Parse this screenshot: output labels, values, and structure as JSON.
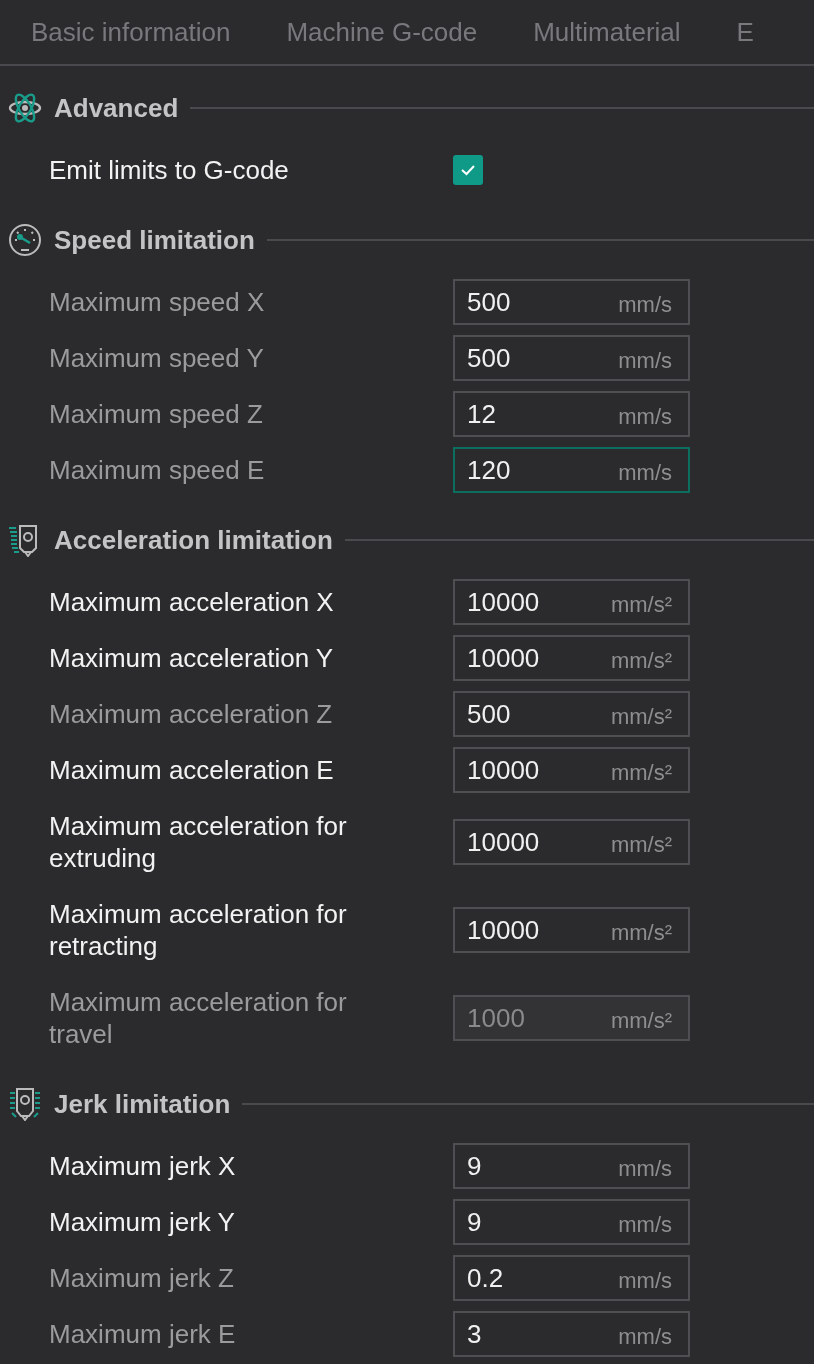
{
  "tabs": [
    {
      "label": "Basic information",
      "selected": false
    },
    {
      "label": "Machine G-code",
      "selected": false
    },
    {
      "label": "Multimaterial",
      "selected": false
    },
    {
      "label": "E",
      "selected": false
    }
  ],
  "sections": [
    {
      "title": "Advanced",
      "rows": [
        {
          "kind": "checkbox",
          "label": "Emit limits to G-code",
          "modified": true,
          "checked": true
        }
      ]
    },
    {
      "title": "Speed limitation",
      "rows": [
        {
          "kind": "field",
          "label": "Maximum speed X",
          "modified": false,
          "value": "500",
          "unit": "mm/s",
          "focused": false,
          "disabled": false
        },
        {
          "kind": "field",
          "label": "Maximum speed Y",
          "modified": false,
          "value": "500",
          "unit": "mm/s",
          "focused": false,
          "disabled": false
        },
        {
          "kind": "field",
          "label": "Maximum speed Z",
          "modified": false,
          "value": "12",
          "unit": "mm/s",
          "focused": false,
          "disabled": false
        },
        {
          "kind": "field",
          "label": "Maximum speed E",
          "modified": false,
          "value": "120",
          "unit": "mm/s",
          "focused": true,
          "disabled": false
        }
      ]
    },
    {
      "title": "Acceleration limitation",
      "rows": [
        {
          "kind": "field",
          "label": "Maximum acceleration X",
          "modified": true,
          "value": "10000",
          "unit": "mm/s²",
          "focused": false,
          "disabled": false
        },
        {
          "kind": "field",
          "label": "Maximum acceleration Y",
          "modified": true,
          "value": "10000",
          "unit": "mm/s²",
          "focused": false,
          "disabled": false
        },
        {
          "kind": "field",
          "label": "Maximum acceleration Z",
          "modified": false,
          "value": "500",
          "unit": "mm/s²",
          "focused": false,
          "disabled": false
        },
        {
          "kind": "field",
          "label": "Maximum acceleration E",
          "modified": true,
          "value": "10000",
          "unit": "mm/s²",
          "focused": false,
          "disabled": false
        },
        {
          "kind": "field",
          "label": "Maximum acceleration for extruding",
          "modified": true,
          "value": "10000",
          "unit": "mm/s²",
          "focused": false,
          "disabled": false
        },
        {
          "kind": "field",
          "label": "Maximum acceleration for retracting",
          "modified": true,
          "value": "10000",
          "unit": "mm/s²",
          "focused": false,
          "disabled": false
        },
        {
          "kind": "field",
          "label": "Maximum acceleration for travel",
          "modified": false,
          "value": "1000",
          "unit": "mm/s²",
          "focused": false,
          "disabled": true
        }
      ]
    },
    {
      "title": "Jerk limitation",
      "rows": [
        {
          "kind": "field",
          "label": "Maximum jerk X",
          "modified": true,
          "value": "9",
          "unit": "mm/s",
          "focused": false,
          "disabled": false
        },
        {
          "kind": "field",
          "label": "Maximum jerk Y",
          "modified": true,
          "value": "9",
          "unit": "mm/s",
          "focused": false,
          "disabled": false
        },
        {
          "kind": "field",
          "label": "Maximum jerk Z",
          "modified": false,
          "value": "0.2",
          "unit": "mm/s",
          "focused": false,
          "disabled": false
        },
        {
          "kind": "field",
          "label": "Maximum jerk E",
          "modified": false,
          "value": "3",
          "unit": "mm/s",
          "focused": false,
          "disabled": false
        }
      ]
    }
  ]
}
